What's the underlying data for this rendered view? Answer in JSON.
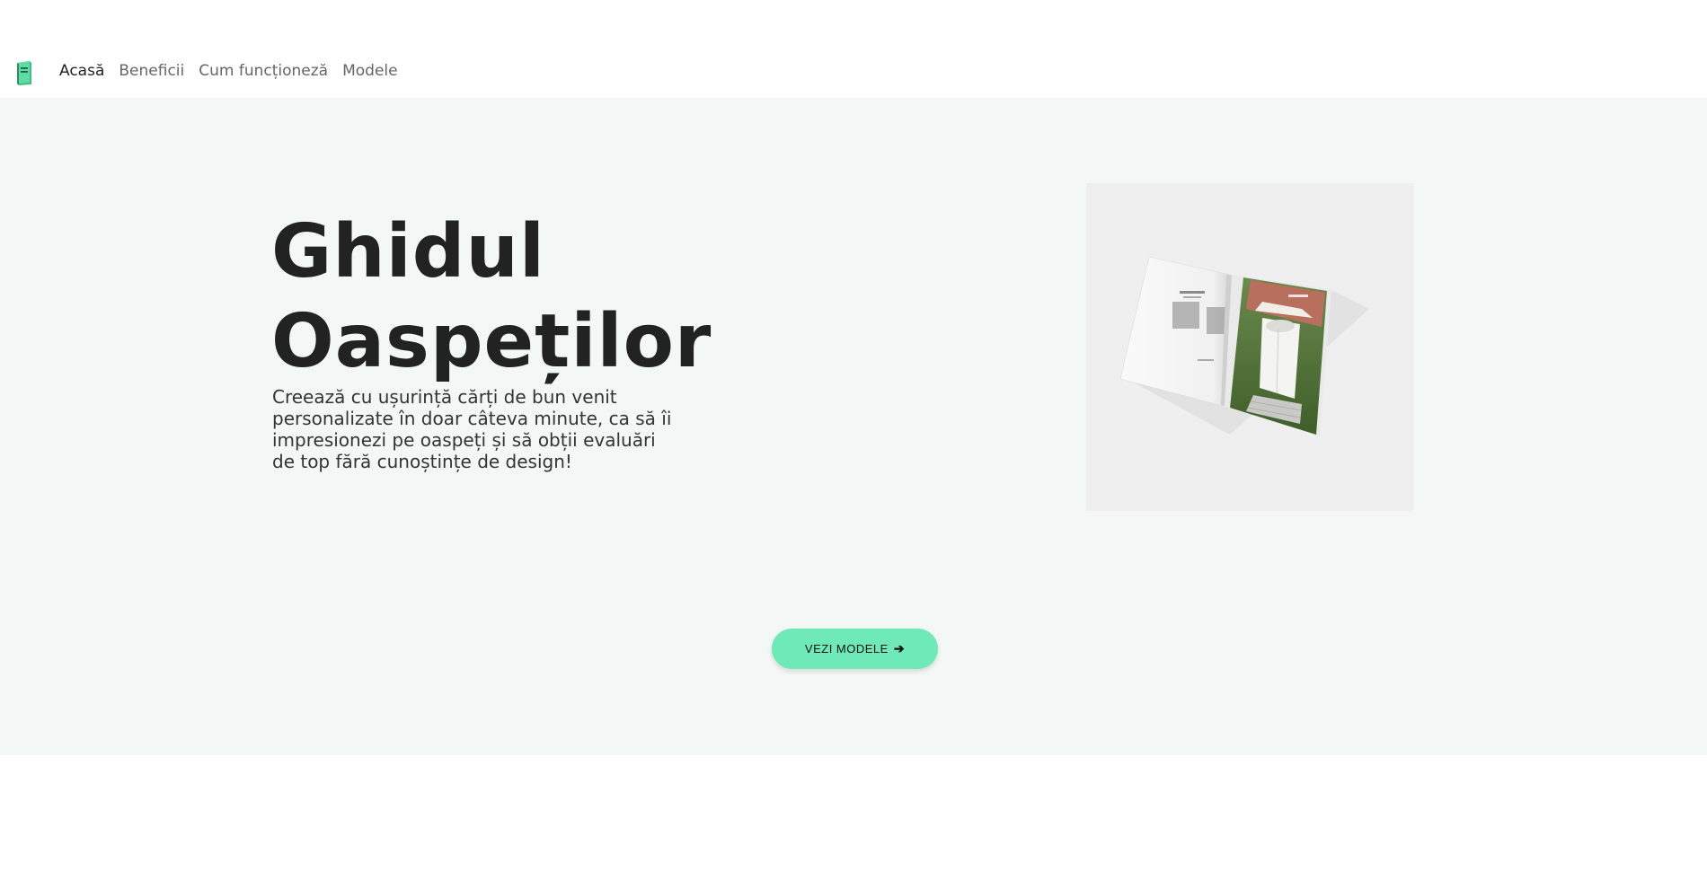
{
  "nav": {
    "logo_icon": "book-icon",
    "links": [
      {
        "label": "Acasă",
        "active": true
      },
      {
        "label": "Beneficii",
        "active": false
      },
      {
        "label": "Cum funcționeză",
        "active": false
      },
      {
        "label": "Modele",
        "active": false
      }
    ]
  },
  "hero": {
    "title_line1": "Ghidul",
    "title_line2": "Oaspeților",
    "description": "Creează cu ușurință cărți de bun venit personalizate în doar câteva minute, ca să îi impresionezi pe oaspeți și să obții evaluări de top fără cunoștințe de design!",
    "image_icon": "open-magazine-mockup",
    "cta_label": "VEZI MODELE",
    "cta_icon": "arrow-right-icon"
  },
  "colors": {
    "accent": "#6ee9b7",
    "hero_background": "#f3f8f6",
    "text": "#222222"
  }
}
